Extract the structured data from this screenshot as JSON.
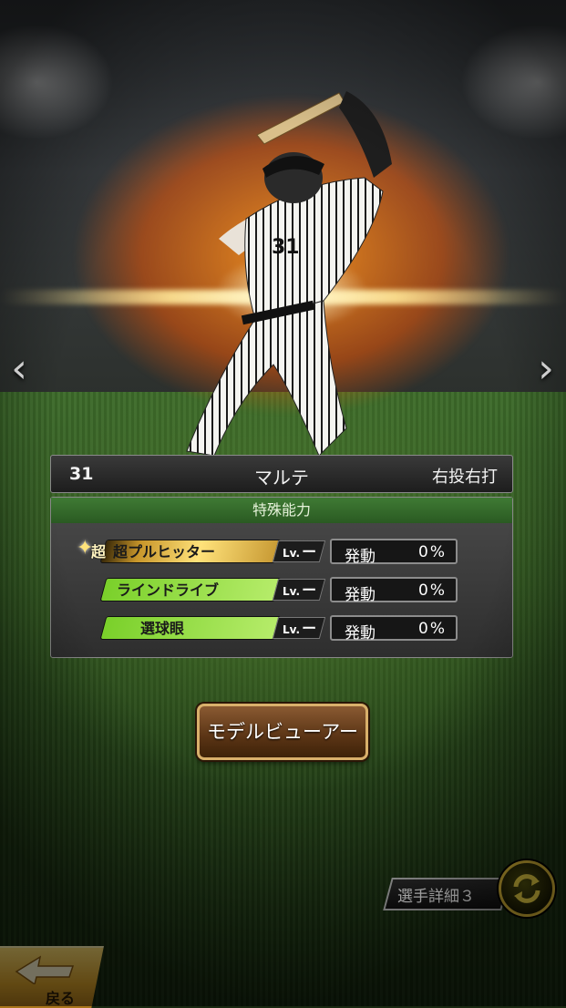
{
  "player": {
    "number": "31",
    "name": "マルテ",
    "handedness": "右投右打"
  },
  "abilities_panel": {
    "title": "特殊能力",
    "abilities": [
      {
        "badge": "超",
        "name": "超プルヒッター",
        "level_label": "Lv.",
        "level": "ー",
        "trigger_label": "発動",
        "trigger_rate": "0%",
        "tier": "gold"
      },
      {
        "name": "ラインドライブ",
        "level_label": "Lv.",
        "level": "ー",
        "trigger_label": "発動",
        "trigger_rate": "0%",
        "tier": "green"
      },
      {
        "name": "選球眼",
        "level_label": "Lv.",
        "level": "ー",
        "trigger_label": "発動",
        "trigger_rate": "0%",
        "tier": "green"
      }
    ]
  },
  "model_viewer_button": "モデルビューアー",
  "player_detail_button": "選手詳細３",
  "back_button": "戻る",
  "nav": {
    "prev": "‹",
    "next": "›"
  },
  "colors": {
    "aura": "#ff8a1e",
    "panel_header": "#3f7a34",
    "gold": "#e6c13a"
  },
  "icons": [
    "chevron-left-icon",
    "chevron-right-icon",
    "swap-icon",
    "back-arrow-icon",
    "sparkle-icon"
  ]
}
